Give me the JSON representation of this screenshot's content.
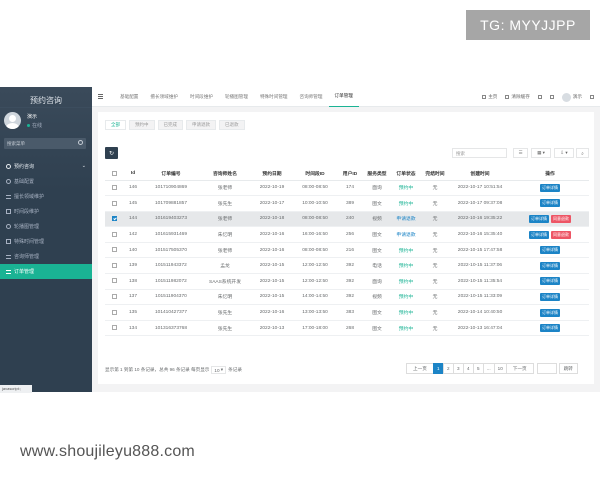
{
  "watermark": {
    "tg": "TG: MYYJJPP",
    "site": "www.shoujileyu888.com"
  },
  "sidebar": {
    "title": "预约咨询",
    "user": "演示",
    "status": "在线",
    "search_placeholder": "搜索菜单",
    "parent": "预约咨询",
    "items": [
      {
        "label": "基础配置"
      },
      {
        "label": "擅长领域维护"
      },
      {
        "label": "时间段维护"
      },
      {
        "label": "轮播图管理"
      },
      {
        "label": "特殊时间管理"
      },
      {
        "label": "咨询师管理"
      },
      {
        "label": "订单管理"
      }
    ],
    "bottom_note": "javascript:;"
  },
  "topnav": {
    "tabs": [
      "基础配置",
      "擅长领域维护",
      "时间段维护",
      "轮播图管理",
      "特殊时间管理",
      "咨询师管理",
      "订单管理"
    ],
    "home": "主页",
    "clear_cache": "清除缓存",
    "user": "演示"
  },
  "filters": [
    "全部",
    "预约中",
    "已完成",
    "申请退款",
    "已退款"
  ],
  "toolbar": {
    "search_placeholder": "搜索"
  },
  "table": {
    "headers": [
      "Id",
      "订单编号",
      "咨询师姓名",
      "预约日期",
      "时间段ID",
      "用户ID",
      "服务类型",
      "订单状态",
      "完结时间",
      "创建时间",
      "操作"
    ],
    "rows": [
      {
        "id": "146",
        "order": "101710904869",
        "name": "张老师",
        "date": "2022-10-19",
        "time": "08:00-08:50",
        "uid": "174",
        "type": "面询",
        "status": "预约中",
        "done": "无",
        "created": "2022-10-17 10:51:54",
        "refund": false
      },
      {
        "id": "145",
        "order": "101709881857",
        "name": "张先生",
        "date": "2022-10-17",
        "time": "10:00-10:50",
        "uid": "389",
        "type": "图文",
        "status": "预约中",
        "done": "无",
        "created": "2022-10-17 09:37:08",
        "refund": false
      },
      {
        "id": "144",
        "order": "101619403273",
        "name": "张老师",
        "date": "2022-10-18",
        "time": "08:00-08:50",
        "uid": "240",
        "type": "视频",
        "status": "申请退款",
        "done": "无",
        "created": "2022-10-16 19:35:22",
        "refund": true
      },
      {
        "id": "142",
        "order": "101615931469",
        "name": "朱忆明",
        "date": "2022-10-16",
        "time": "16:00-16:50",
        "uid": "256",
        "type": "图文",
        "status": "申请退款",
        "done": "无",
        "created": "2022-10-16 15:35:40",
        "refund": true
      },
      {
        "id": "140",
        "order": "101517505370",
        "name": "张老师",
        "date": "2022-10-16",
        "time": "08:00-08:50",
        "uid": "216",
        "type": "图文",
        "status": "预约中",
        "done": "无",
        "created": "2022-10-15 17:47:58",
        "refund": false
      },
      {
        "id": "139",
        "order": "101511943372",
        "name": "孟龙",
        "date": "2022-10-15",
        "time": "12:00-12:50",
        "uid": "392",
        "type": "电话",
        "status": "预约中",
        "done": "无",
        "created": "2022-10-15 11:37:06",
        "refund": false
      },
      {
        "id": "138",
        "order": "101511982072",
        "name": "SAAS系统开发",
        "date": "2022-10-15",
        "time": "12:00-12:50",
        "uid": "392",
        "type": "面询",
        "status": "预约中",
        "done": "无",
        "created": "2022-10-15 11:35:54",
        "refund": false
      },
      {
        "id": "137",
        "order": "101511904370",
        "name": "朱忆明",
        "date": "2022-10-15",
        "time": "14:00-14:50",
        "uid": "392",
        "type": "视频",
        "status": "预约中",
        "done": "无",
        "created": "2022-10-15 11:33:09",
        "refund": false
      },
      {
        "id": "135",
        "order": "101410427377",
        "name": "张先生",
        "date": "2022-10-16",
        "time": "13:00-13:50",
        "uid": "383",
        "type": "图文",
        "status": "预约中",
        "done": "无",
        "created": "2022-10-14 10:40:50",
        "refund": false
      },
      {
        "id": "134",
        "order": "101316373768",
        "name": "张先生",
        "date": "2022-10-13",
        "time": "17:00-18:00",
        "uid": "268",
        "type": "图文",
        "status": "预约中",
        "done": "无",
        "created": "2022-10-13 16:47:04",
        "refund": false
      }
    ],
    "detail_label": "订单详情",
    "refund_label": "同意退款"
  },
  "footer": {
    "info_prefix": "显示第 1 到第 10 条记录，总共 96 条记录 每页显示",
    "per_page": "10",
    "info_suffix": "条记录",
    "prev": "上一页",
    "pages": [
      "1",
      "2",
      "3",
      "4",
      "5",
      "...",
      "10"
    ],
    "next": "下一页",
    "jump": "跳转"
  }
}
